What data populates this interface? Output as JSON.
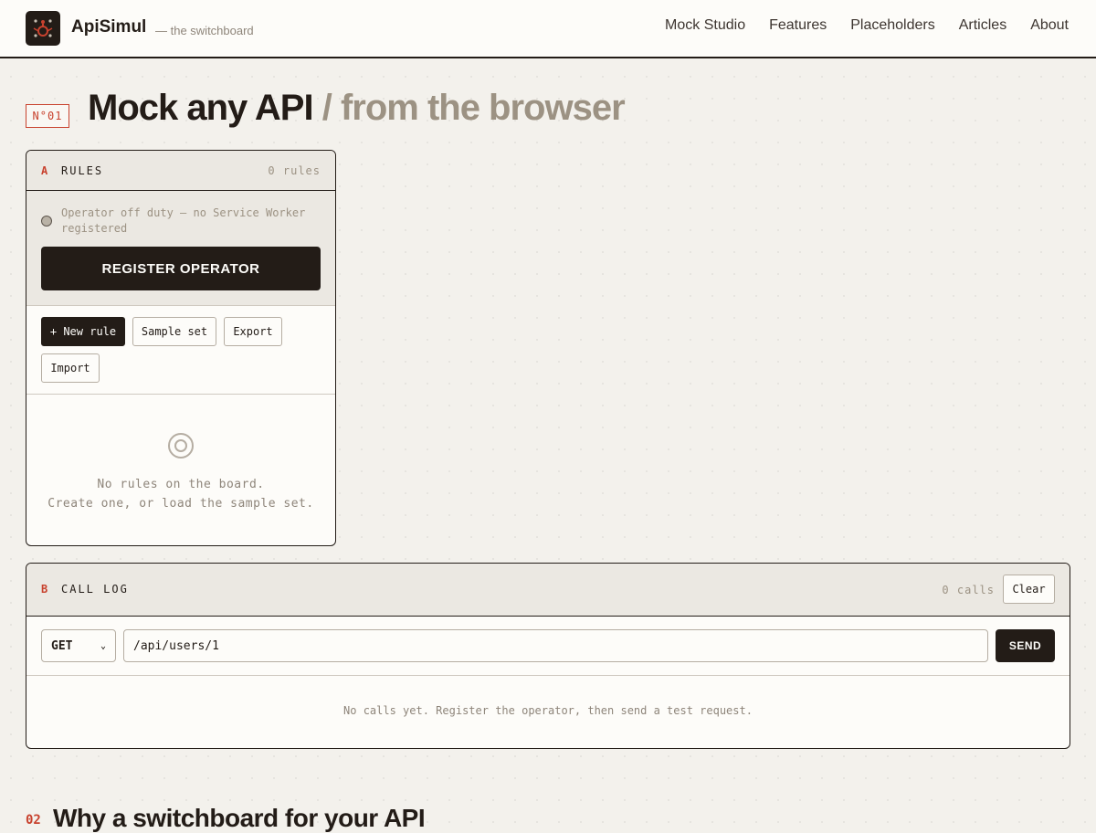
{
  "header": {
    "brand": "ApiSimul",
    "tagline": "— the switchboard",
    "nav": [
      "Mock Studio",
      "Features",
      "Placeholders",
      "Articles",
      "About"
    ]
  },
  "hero": {
    "badge": "N°01",
    "title": "Mock any API",
    "title_suffix": "/ from the browser"
  },
  "rules_panel": {
    "letter": "A",
    "title": "RULES",
    "count": "0 rules",
    "status_text": "Operator off duty — no Service Worker registered",
    "register_button": "REGISTER OPERATOR",
    "toolbar": {
      "new_rule": "+ New rule",
      "sample_set": "Sample set",
      "export": "Export",
      "import": "Import"
    },
    "empty_line1": "No rules on the board.",
    "empty_line2": "Create one, or load the sample set."
  },
  "call_log": {
    "letter": "B",
    "title": "CALL LOG",
    "count": "0 calls",
    "clear_button": "Clear",
    "method": "GET",
    "url": "/api/users/1",
    "send_button": "SEND",
    "empty_text": "No calls yet. Register the operator, then send a test request."
  },
  "next_section": {
    "number": "02",
    "title": "Why a switchboard for your API"
  },
  "colors": {
    "accent": "#c8422e",
    "ink": "#231c17",
    "paper": "#fdfcf9",
    "background": "#f3f1ec"
  }
}
